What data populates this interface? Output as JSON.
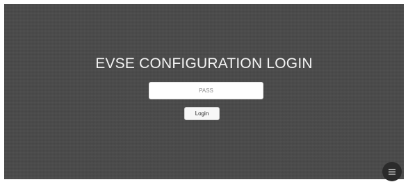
{
  "login": {
    "title": "EVSE CONFIGURATION LOGIN",
    "password_placeholder": "PASS",
    "password_value": "",
    "login_label": "Login"
  },
  "menu": {
    "icon": "hamburger-menu-icon"
  },
  "colors": {
    "background": "#4a4a4a",
    "title_text": "#f4f4f4",
    "input_bg": "#ffffff",
    "button_bg": "#f7f7f7",
    "menu_button_bg": "#2b2b2b"
  }
}
